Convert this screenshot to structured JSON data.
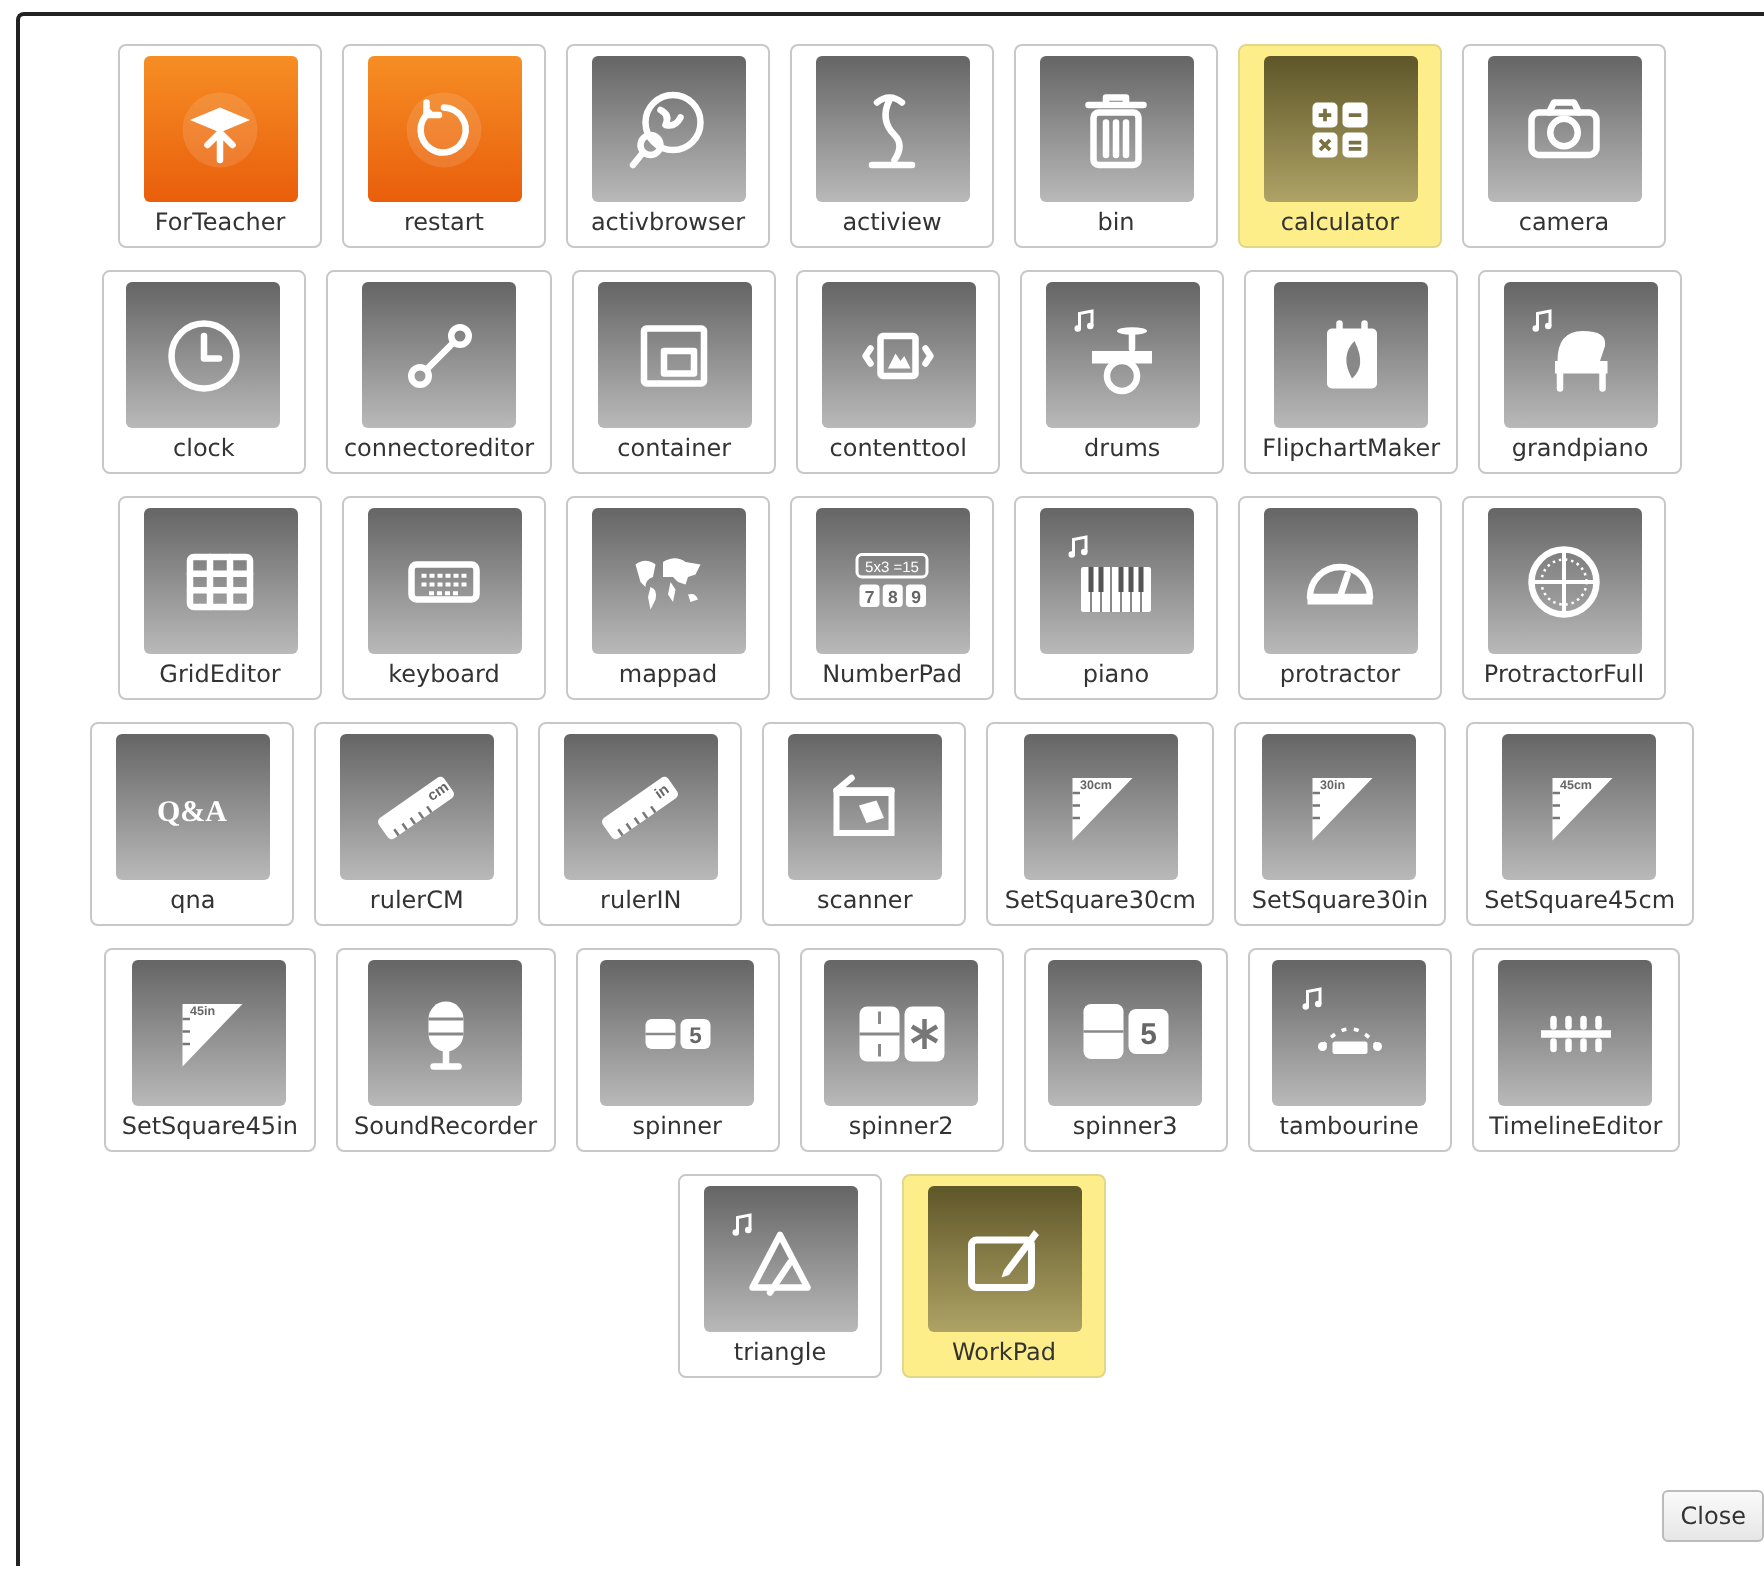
{
  "rows": [
    [
      {
        "label": "ForTeacher",
        "kind": "special",
        "selected": false
      },
      {
        "label": "restart",
        "kind": "special",
        "selected": false
      },
      {
        "label": "activbrowser",
        "kind": "tool",
        "selected": false
      },
      {
        "label": "actiview",
        "kind": "tool",
        "selected": false
      },
      {
        "label": "bin",
        "kind": "tool",
        "selected": false
      },
      {
        "label": "calculator",
        "kind": "tool",
        "selected": true
      },
      {
        "label": "camera",
        "kind": "tool",
        "selected": false
      }
    ],
    [
      {
        "label": "clock",
        "kind": "tool",
        "selected": false
      },
      {
        "label": "connectoreditor",
        "kind": "tool",
        "selected": false
      },
      {
        "label": "container",
        "kind": "tool",
        "selected": false
      },
      {
        "label": "contenttool",
        "kind": "tool",
        "selected": false
      },
      {
        "label": "drums",
        "kind": "tool",
        "selected": false
      },
      {
        "label": "FlipchartMaker",
        "kind": "tool",
        "selected": false
      },
      {
        "label": "grandpiano",
        "kind": "tool",
        "selected": false
      }
    ],
    [
      {
        "label": "GridEditor",
        "kind": "tool",
        "selected": false
      },
      {
        "label": "keyboard",
        "kind": "tool",
        "selected": false
      },
      {
        "label": "mappad",
        "kind": "tool",
        "selected": false
      },
      {
        "label": "NumberPad",
        "kind": "tool",
        "selected": false,
        "icon_text": [
          "5x3 =15",
          "7",
          "8",
          "9"
        ]
      },
      {
        "label": "piano",
        "kind": "tool",
        "selected": false
      },
      {
        "label": "protractor",
        "kind": "tool",
        "selected": false
      },
      {
        "label": "ProtractorFull",
        "kind": "tool",
        "selected": false
      }
    ],
    [
      {
        "label": "qna",
        "kind": "tool",
        "selected": false,
        "icon_text": [
          "Q&A"
        ]
      },
      {
        "label": "rulerCM",
        "kind": "tool",
        "selected": false,
        "icon_text": [
          "cm"
        ]
      },
      {
        "label": "rulerIN",
        "kind": "tool",
        "selected": false,
        "icon_text": [
          "in"
        ]
      },
      {
        "label": "scanner",
        "kind": "tool",
        "selected": false
      },
      {
        "label": "SetSquare30cm",
        "kind": "tool",
        "selected": false,
        "icon_text": [
          "30cm"
        ]
      },
      {
        "label": "SetSquare30in",
        "kind": "tool",
        "selected": false,
        "icon_text": [
          "30in"
        ]
      },
      {
        "label": "SetSquare45cm",
        "kind": "tool",
        "selected": false,
        "icon_text": [
          "45cm"
        ]
      }
    ],
    [
      {
        "label": "SetSquare45in",
        "kind": "tool",
        "selected": false,
        "icon_text": [
          "45in"
        ]
      },
      {
        "label": "SoundRecorder",
        "kind": "tool",
        "selected": false
      },
      {
        "label": "spinner",
        "kind": "tool",
        "selected": false,
        "icon_text": [
          "5"
        ]
      },
      {
        "label": "spinner2",
        "kind": "tool",
        "selected": false
      },
      {
        "label": "spinner3",
        "kind": "tool",
        "selected": false,
        "icon_text": [
          "5"
        ]
      },
      {
        "label": "tambourine",
        "kind": "tool",
        "selected": false
      },
      {
        "label": "TimelineEditor",
        "kind": "tool",
        "selected": false
      }
    ],
    [
      {
        "label": "triangle",
        "kind": "tool",
        "selected": false
      },
      {
        "label": "WorkPad",
        "kind": "tool",
        "selected": true
      }
    ]
  ],
  "close_button": "Close"
}
